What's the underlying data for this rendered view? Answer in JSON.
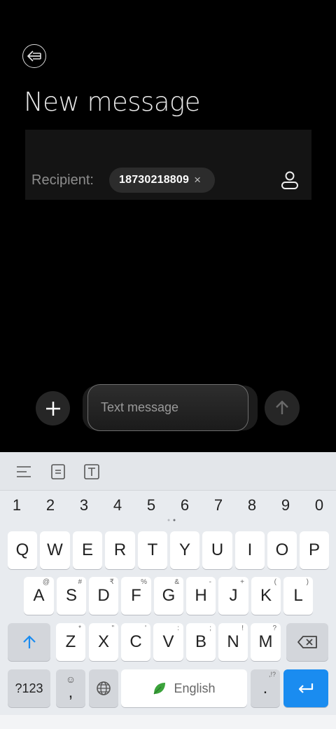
{
  "header": {
    "title": "New message",
    "back_icon": "back-arrow-icon"
  },
  "recipient": {
    "label": "Recipient:",
    "chip_text": "18730218809",
    "chip_remove": "×",
    "contact_icon": "contact-person-icon"
  },
  "composer": {
    "placeholder": "Text message",
    "add_icon": "plus-icon",
    "send_icon": "send-arrow-up-icon"
  },
  "keyboard": {
    "toolbar_icons": [
      "menu-lines-icon",
      "clipboard-icon",
      "text-box-icon"
    ],
    "number_row": [
      "1",
      "2",
      "3",
      "4",
      "5",
      "6",
      "7",
      "8",
      "9",
      "0"
    ],
    "row1": [
      "Q",
      "W",
      "E",
      "R",
      "T",
      "Y",
      "U",
      "I",
      "O",
      "P"
    ],
    "row2": [
      "A",
      "S",
      "D",
      "F",
      "G",
      "H",
      "J",
      "K",
      "L"
    ],
    "row2_sup": [
      "@",
      "#",
      "₹",
      "%",
      "&",
      "-",
      "+",
      "(",
      ")"
    ],
    "row3": [
      "Z",
      "X",
      "C",
      "V",
      "B",
      "N",
      "M"
    ],
    "row3_sup": [
      "*",
      "\"",
      "'",
      ":",
      ";",
      "!",
      "?"
    ],
    "symbols_key": "?123",
    "comma_key": ",",
    "comma_sup": "☺",
    "space_label": "English",
    "period_key": ".",
    "period_sup": ",!?",
    "accent_color": "#1a8cf0"
  }
}
